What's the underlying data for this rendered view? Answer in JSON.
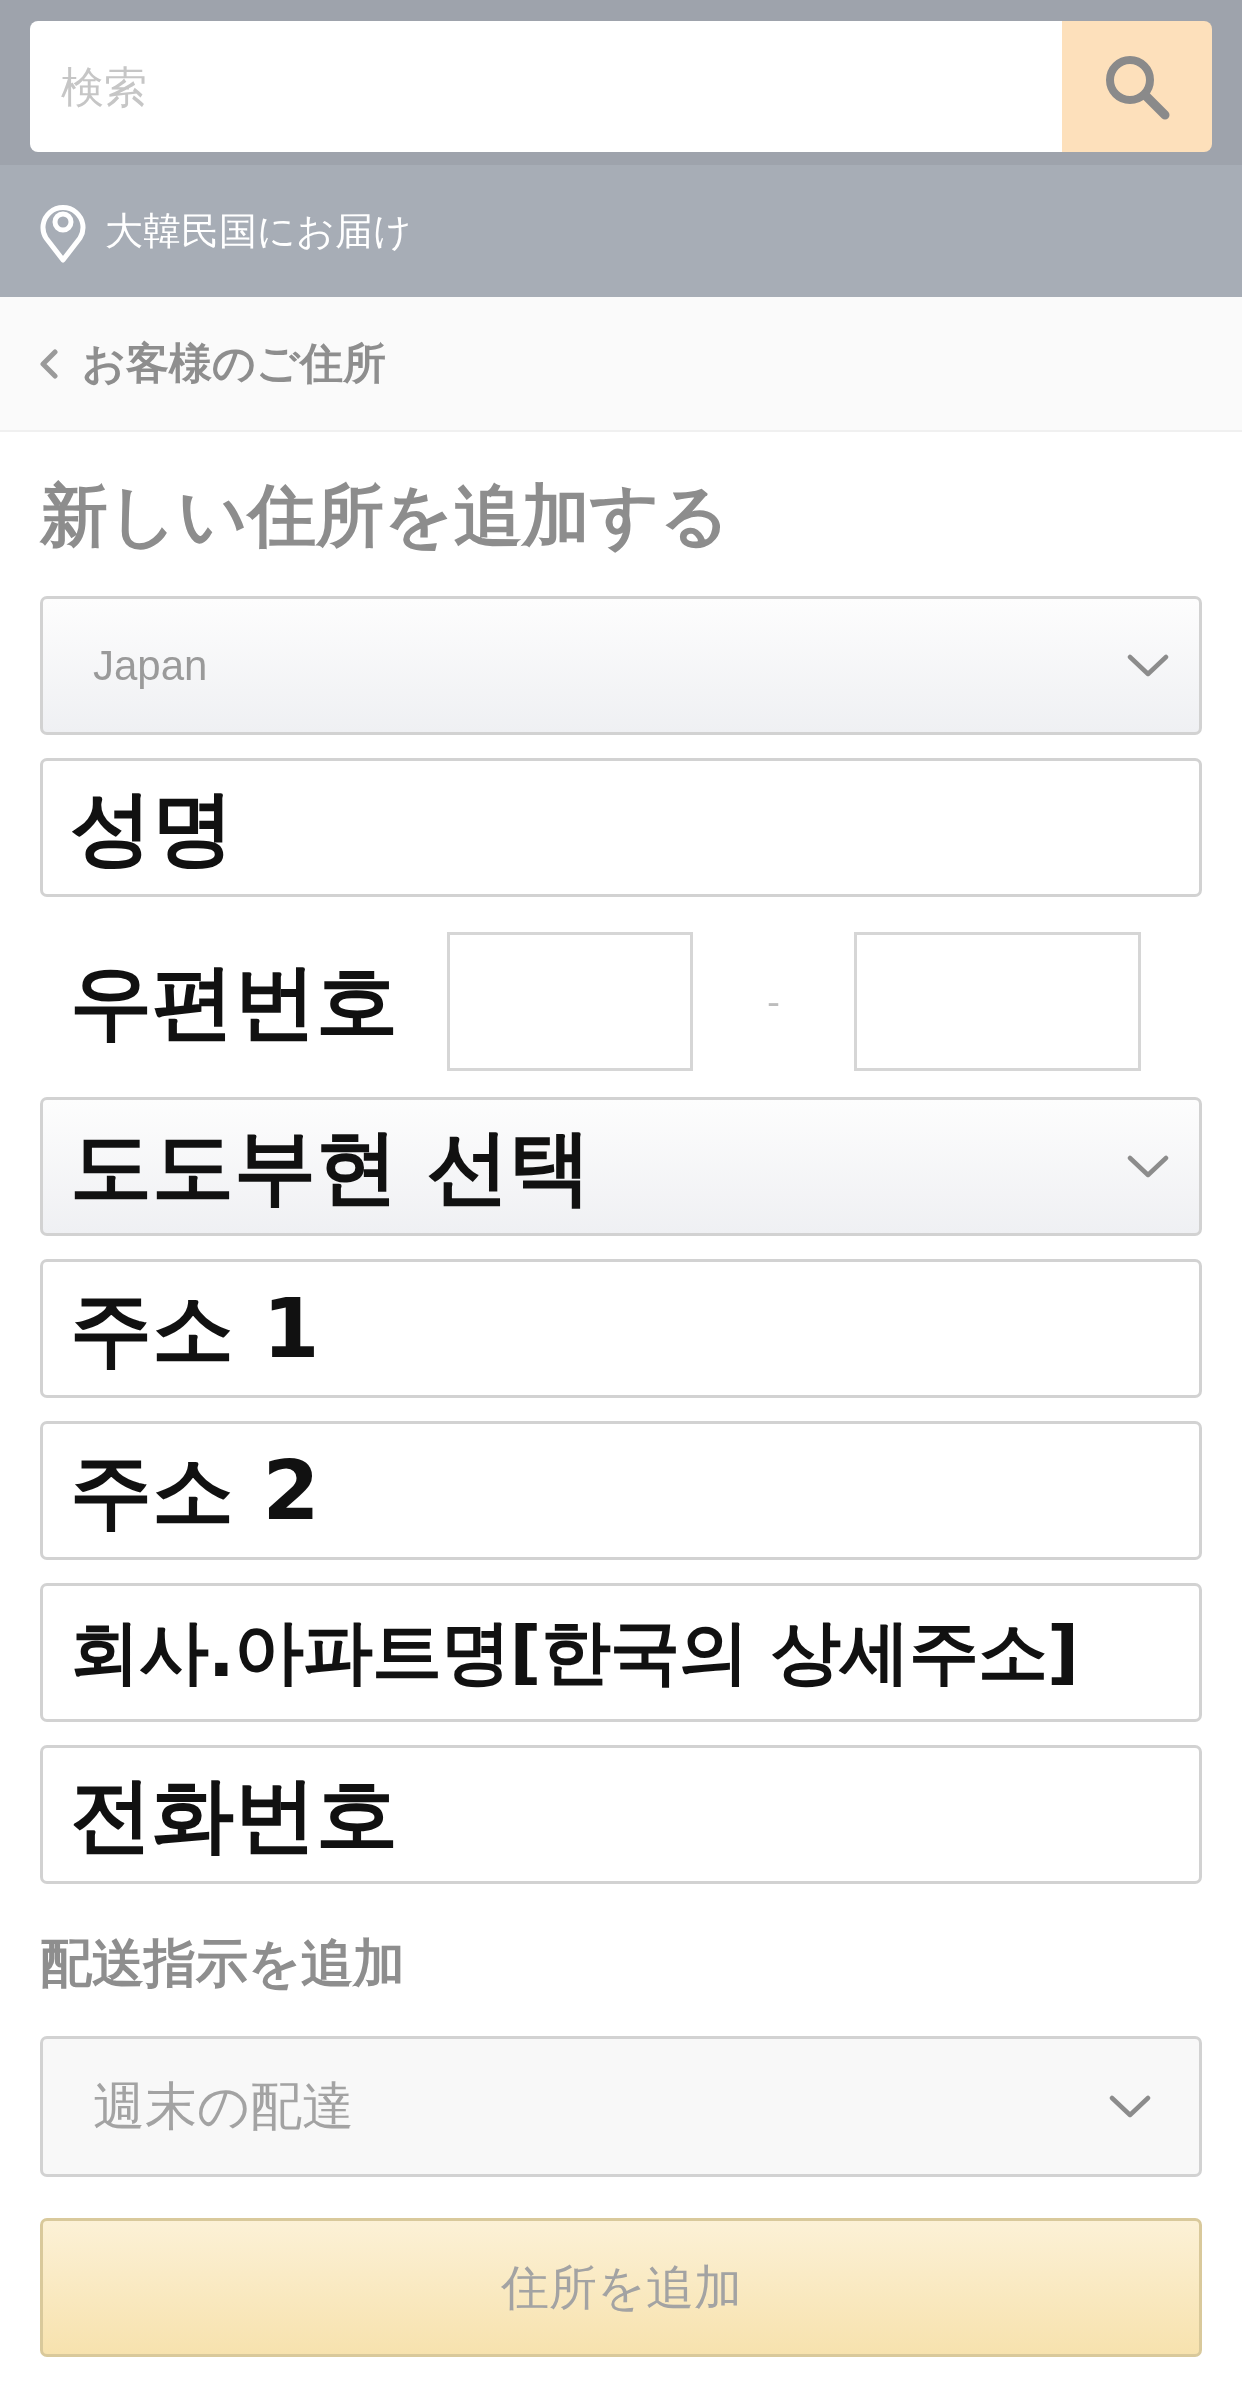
{
  "search": {
    "placeholder": "検索"
  },
  "delivery_bar": {
    "text": "大韓民国にお届け"
  },
  "breadcrumb": {
    "label": "お客様のご住所"
  },
  "heading": "新しい住所を追加する",
  "form": {
    "fields": [
      {
        "kind": "select",
        "value": "Japan"
      },
      {
        "kind": "text",
        "annotation": "성명"
      },
      {
        "kind": "postal",
        "separator": "-",
        "annotation": "우편번호"
      },
      {
        "kind": "select",
        "annotation": "도도부현 선택"
      },
      {
        "kind": "text",
        "annotation": "주소 1"
      },
      {
        "kind": "text",
        "annotation": "주소 2"
      },
      {
        "kind": "text",
        "annotation": "회사.아파트명[한국의 상세주소]"
      },
      {
        "kind": "text",
        "annotation": "전화번호"
      }
    ]
  },
  "delivery_instructions": {
    "label": "配送指示を追加",
    "select": {
      "value": "週末の配達"
    }
  },
  "submit_button": {
    "label": "住所を追加"
  }
}
